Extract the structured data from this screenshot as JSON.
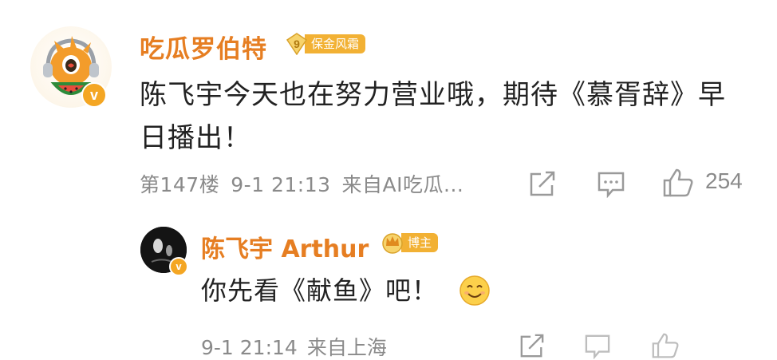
{
  "comment": {
    "username": "吃瓜罗伯特",
    "fan_badge": {
      "level": "9",
      "label": "保金风霜"
    },
    "verified_mark": "v",
    "text": "陈飞宇今天也在努力营业哦，期待《慕胥辞》早日播出！",
    "floor": "第147楼",
    "time": "9-1 21:13",
    "source": "来自AI吃瓜...",
    "likes": "254",
    "icons": [
      "share-icon",
      "comment-icon",
      "like-icon"
    ]
  },
  "reply": {
    "username": "陈飞宇 Arthur",
    "badge_label": "博主",
    "verified_mark": "v",
    "text": "你先看《献鱼》吧！",
    "emoji": "smile-emoji",
    "time": "9-1 21:14",
    "source": "来自上海",
    "icons": [
      "share-icon",
      "comment-icon",
      "like-icon"
    ]
  },
  "colors": {
    "username": "#e67e22",
    "badge": "#f2b134",
    "text": "#222222",
    "meta": "#8a8a8a"
  }
}
